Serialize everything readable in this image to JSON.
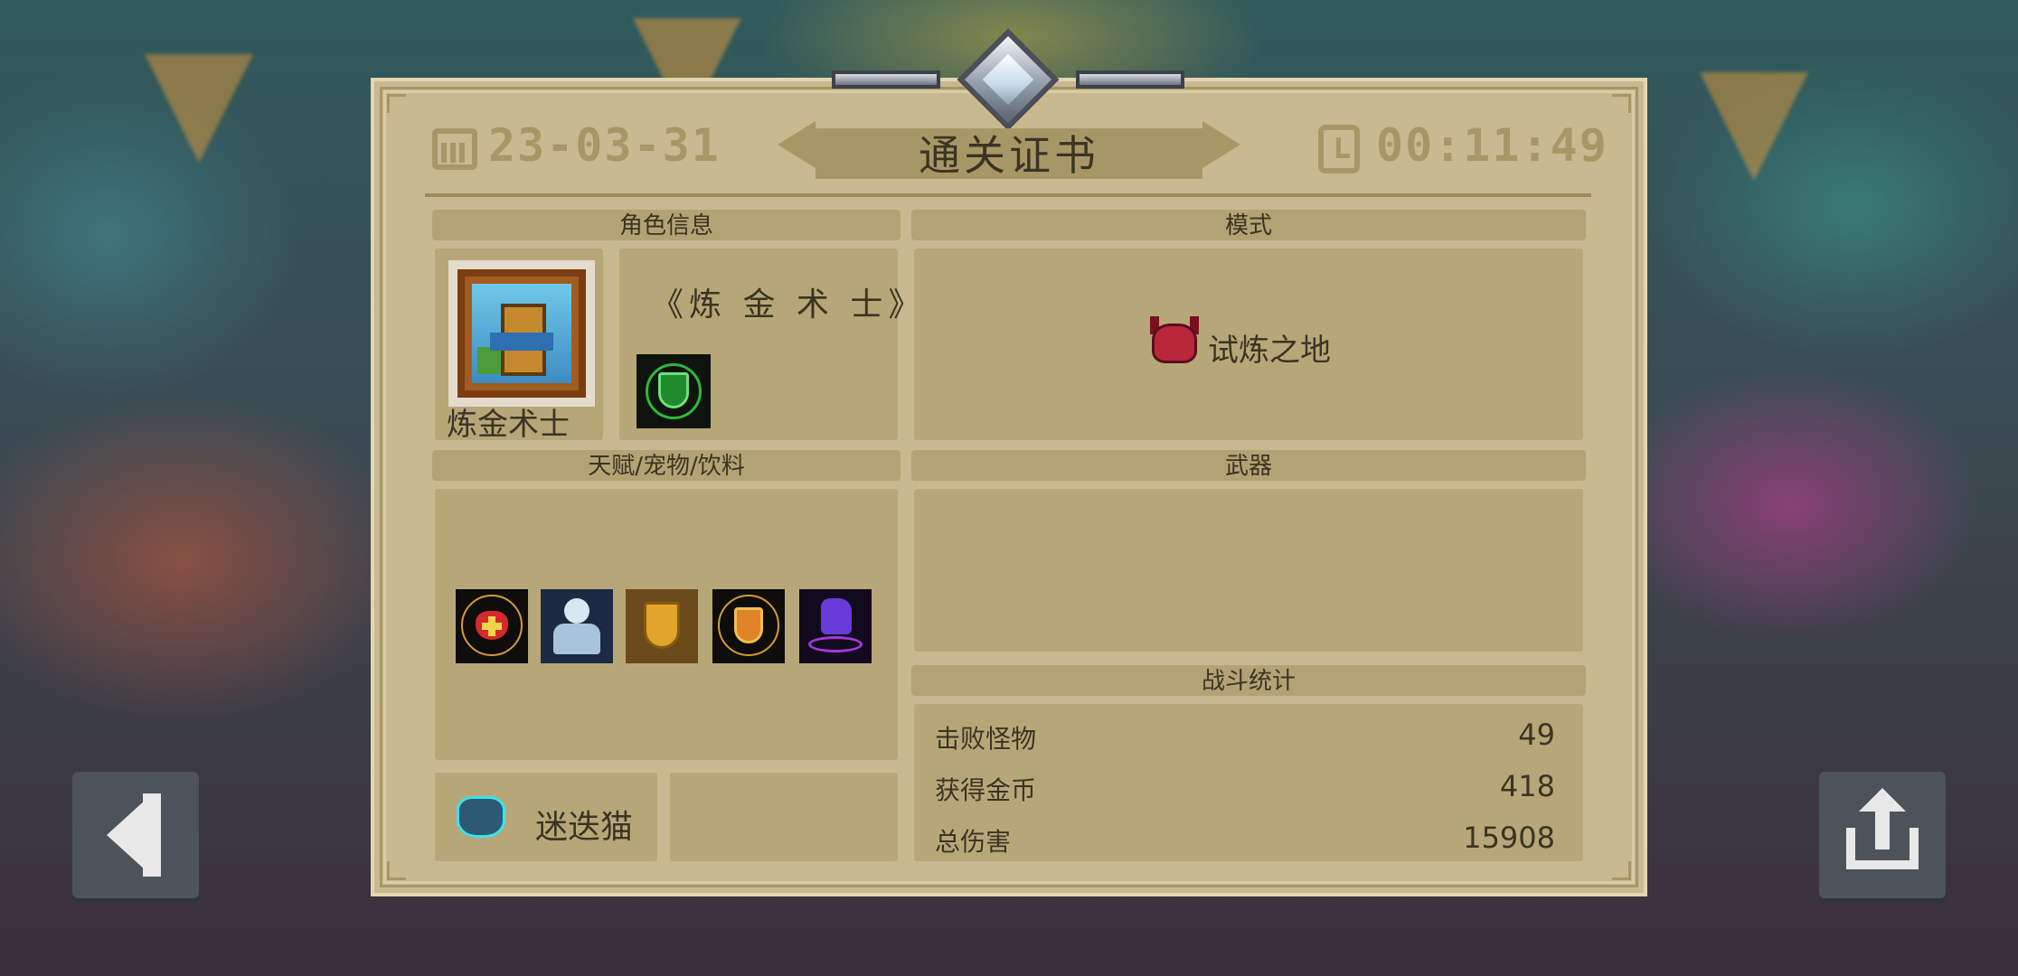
{
  "header": {
    "date": "23-03-31",
    "title": "通关证书",
    "time": "00:11:49"
  },
  "character_info": {
    "section_title": "角色信息",
    "character_name": "炼金术士",
    "skin_title": "《炼 金 术 士》",
    "skill_icon": "green-shield-icon"
  },
  "mode": {
    "section_title": "模式",
    "icon": "demon-skull-icon",
    "label": "试炼之地"
  },
  "talents": {
    "section_title": "天赋/宠物/饮料",
    "icons": [
      "heart-heal-icon",
      "ghost-statue-icon",
      "golden-shield-icon",
      "fire-shield-icon",
      "purple-hand-icon"
    ],
    "pet_icon": "cat-icon",
    "pet_name": "迷迭猫"
  },
  "weapons": {
    "section_title": "武器"
  },
  "battle_stats": {
    "section_title": "战斗统计",
    "rows": [
      {
        "label": "击败怪物",
        "value": "49"
      },
      {
        "label": "获得金币",
        "value": "418"
      },
      {
        "label": "总伤害",
        "value": "15908"
      }
    ]
  },
  "buttons": {
    "back": "back-arrow-icon",
    "share": "share-icon"
  }
}
